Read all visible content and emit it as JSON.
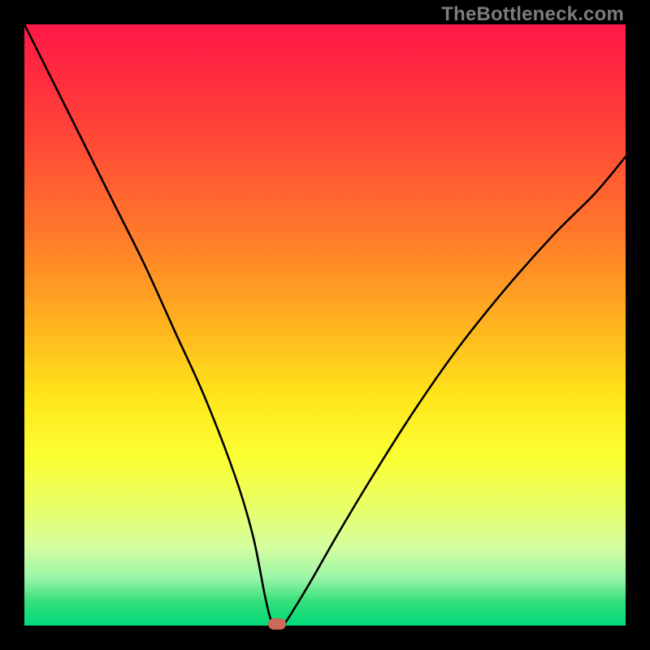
{
  "watermark": "TheBottleneck.com",
  "colors": {
    "frame": "#000000",
    "gradient_top": "#ff1847",
    "gradient_bottom": "#00d97a",
    "curve": "#000000",
    "marker": "#cc6a5a"
  },
  "chart_data": {
    "type": "line",
    "title": "",
    "xlabel": "",
    "ylabel": "",
    "xlim": [
      0,
      100
    ],
    "ylim": [
      0,
      100
    ],
    "series": [
      {
        "name": "bottleneck-curve",
        "x": [
          0,
          5,
          10,
          15,
          20,
          25,
          30,
          35,
          38,
          40,
          41,
          42,
          43,
          45,
          48,
          52,
          58,
          65,
          72,
          80,
          88,
          95,
          100
        ],
        "values": [
          100,
          90,
          80,
          70,
          60,
          49,
          38,
          25,
          15,
          5,
          1,
          0,
          0,
          3,
          8,
          15,
          25,
          36,
          46,
          56,
          65,
          72,
          78
        ]
      }
    ],
    "annotations": [
      {
        "name": "minimum-marker",
        "x": 42,
        "y": 0
      }
    ]
  }
}
